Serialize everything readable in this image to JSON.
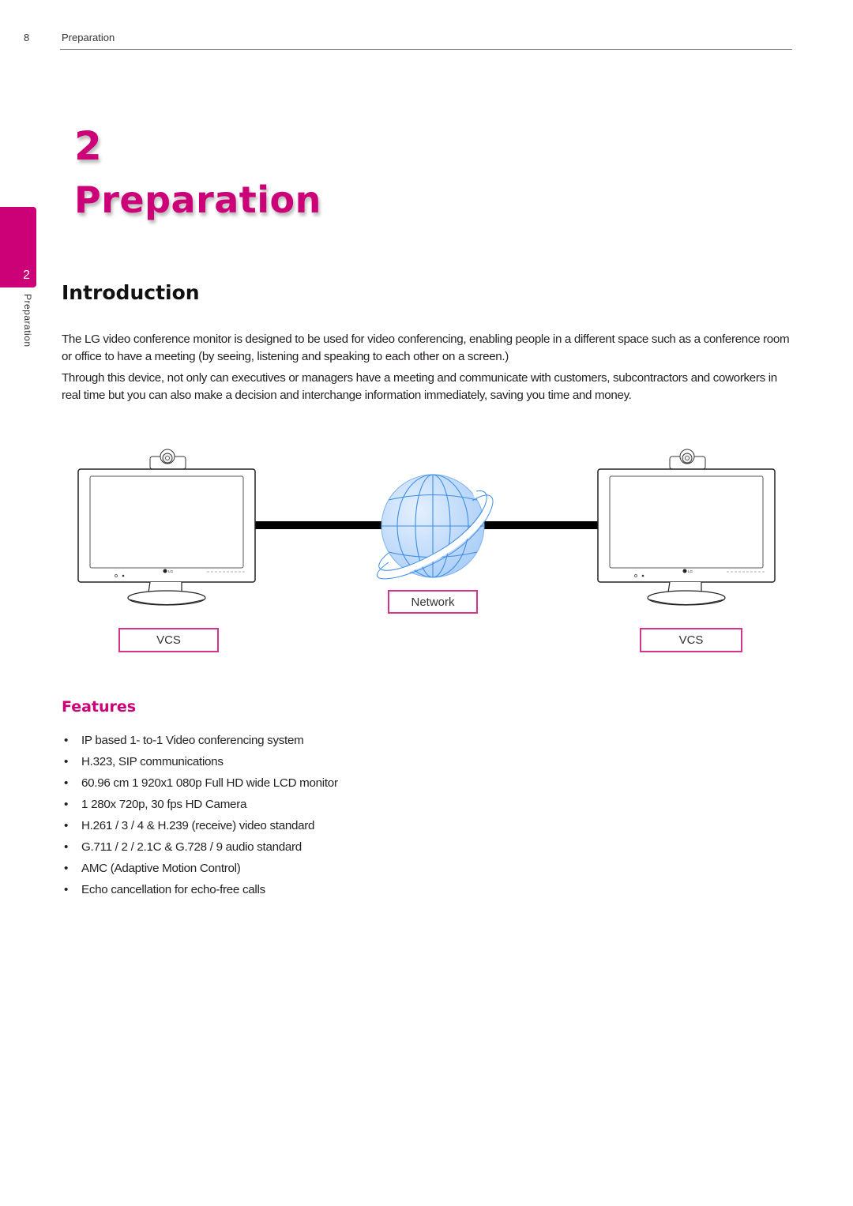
{
  "header": {
    "page_number": "8",
    "section_title": "Preparation"
  },
  "chapter": {
    "number": "2",
    "title": "Preparation"
  },
  "side_tab": {
    "number": "2",
    "label": "Preparation"
  },
  "introduction": {
    "heading": "Introduction",
    "paragraphs": [
      "The LG video conference monitor is designed to be used for video conferencing, enabling people in a different space such as a conference room or office to have a meeting (by seeing, listening and speaking to each other on a screen.)",
      "Through this device, not only can executives or managers have a meeting and communicate with customers, subcontractors and coworkers in real time but you can also make a decision and interchange information immediately, saving you time and money."
    ]
  },
  "diagram": {
    "left_label": "VCS",
    "right_label": "VCS",
    "network_label": "Network",
    "monitor_brand": "LG",
    "icons": [
      "monitor-with-camera-icon",
      "globe-network-icon",
      "monitor-with-camera-icon"
    ],
    "colors": {
      "label_border": "#d6338a",
      "globe_fill": "#bcd8fa",
      "globe_line": "#3d8ee6",
      "link_line": "#000000"
    }
  },
  "features": {
    "heading": "Features",
    "bullet": "•",
    "items": [
      "IP based 1- to-1 Video conferencing system",
      "H.323, SIP communications",
      "60.96 cm 1 920x1 080p Full HD wide LCD monitor",
      "1 280x 720p, 30 fps HD Camera",
      "H.261 / 3 / 4 & H.239 (receive) video standard",
      "G.711 / 2 / 2.1C & G.728 / 9 audio standard",
      "AMC (Adaptive Motion Control)",
      "Echo cancellation for echo-free calls"
    ]
  },
  "colors": {
    "accent": "#cc0077",
    "text": "#231f20"
  }
}
